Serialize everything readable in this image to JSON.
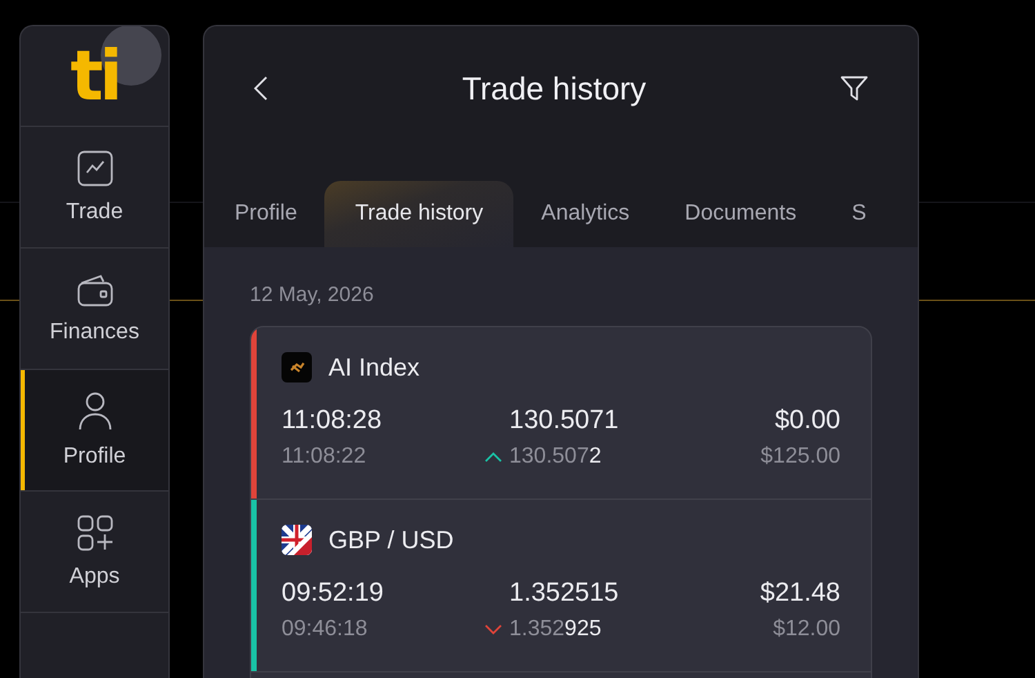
{
  "sidebar": {
    "logo": "ti",
    "items": [
      {
        "label": "Trade",
        "selected": false
      },
      {
        "label": "Finances",
        "selected": false
      },
      {
        "label": "Profile",
        "selected": true
      },
      {
        "label": "Apps",
        "selected": false
      }
    ]
  },
  "header": {
    "title": "Trade history"
  },
  "tabs": [
    {
      "label": "Profile",
      "selected": false
    },
    {
      "label": "Trade history",
      "selected": true
    },
    {
      "label": "Analytics",
      "selected": false
    },
    {
      "label": "Documents",
      "selected": false
    },
    {
      "label": "S",
      "selected": false
    }
  ],
  "date": "12 May, 2026",
  "trades": [
    {
      "kind": "index",
      "name": "AI Index",
      "color": "#e0443a",
      "close_time": "11:08:28",
      "open_time": "11:08:22",
      "close_price": "130.5071",
      "open_price": "130.507**2**",
      "rising": true,
      "profit": "$0.00",
      "amount": "$125.00"
    },
    {
      "kind": "currency",
      "name": "GBP / USD",
      "color": "#19c2a6",
      "close_time": "09:52:19",
      "open_time": "09:46:18",
      "close_price": "1.352515",
      "open_price": "1.352**925**",
      "rising": false,
      "profit": "$21.48",
      "amount": "$12.00"
    }
  ]
}
